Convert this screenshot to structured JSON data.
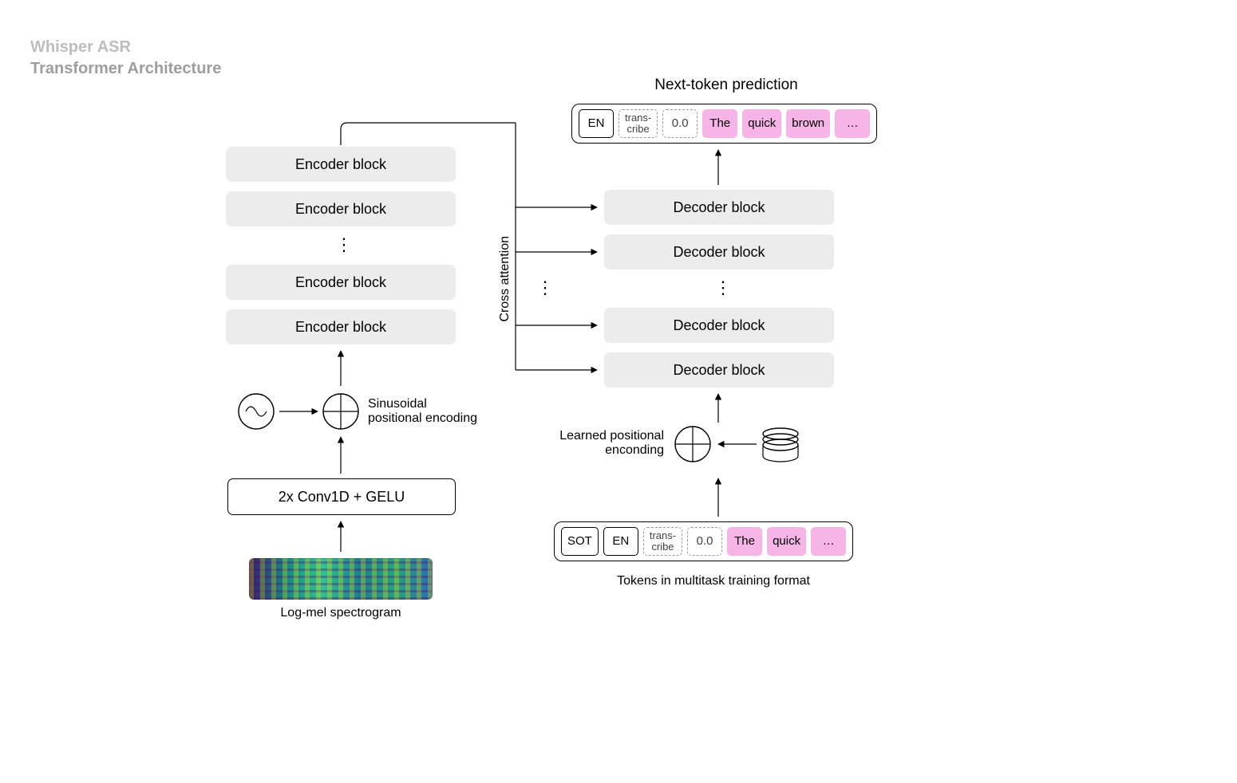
{
  "header": {
    "line1": "Whisper ASR",
    "line2": "Transformer Architecture"
  },
  "encoder": {
    "blocks": [
      "Encoder block",
      "Encoder block",
      "Encoder block",
      "Encoder block"
    ],
    "pos_enc_label": "Sinusoidal\npositional encoding",
    "conv_label": "2x Conv1D + GELU",
    "spectro_caption": "Log-mel spectrogram"
  },
  "decoder": {
    "title": "Next-token prediction",
    "blocks": [
      "Decoder block",
      "Decoder block",
      "Decoder block",
      "Decoder block"
    ],
    "pos_enc_label": "Learned positional\nenconding",
    "input_caption": "Tokens in multitask training format"
  },
  "cross_attention_label": "Cross attention",
  "vdots": "⋮",
  "output_tokens": [
    {
      "text": "EN",
      "style": "solid"
    },
    {
      "text": "trans-\ncribe",
      "style": "dashed small"
    },
    {
      "text": "0.0",
      "style": "dashed"
    },
    {
      "text": "The",
      "style": "pink"
    },
    {
      "text": "quick",
      "style": "pink"
    },
    {
      "text": "brown",
      "style": "pink"
    },
    {
      "text": "…",
      "style": "pink"
    }
  ],
  "input_tokens": [
    {
      "text": "SOT",
      "style": "solid"
    },
    {
      "text": "EN",
      "style": "solid"
    },
    {
      "text": "trans-\ncribe",
      "style": "dashed small"
    },
    {
      "text": "0.0",
      "style": "dashed"
    },
    {
      "text": "The",
      "style": "pink"
    },
    {
      "text": "quick",
      "style": "pink"
    },
    {
      "text": "…",
      "style": "pink"
    }
  ]
}
